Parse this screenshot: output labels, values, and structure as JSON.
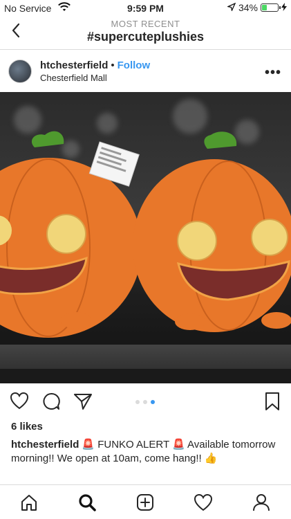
{
  "status_bar": {
    "carrier": "No Service",
    "time": "9:59 PM",
    "battery_percent_label": "34%",
    "battery_level": 0.34,
    "battery_color": "#4cd964"
  },
  "header": {
    "subtitle": "MOST RECENT",
    "title": "#supercuteplushies",
    "back_icon": "chevron-left-icon"
  },
  "post": {
    "username": "htchesterfield",
    "dot": "•",
    "follow_label": "Follow",
    "location": "Chesterfield Mall",
    "more_icon": "ellipsis-icon",
    "more_label": "•••",
    "image_description": "",
    "carousel": {
      "count": 3,
      "active_index": 2
    },
    "likes": "6 likes",
    "caption_user": "htchesterfield",
    "caption_text": "🚨 FUNKO ALERT 🚨 Available tomorrow morning!! We open at 10am, come hang!! 👍"
  },
  "actions": {
    "icons": [
      "heart-icon",
      "comment-icon",
      "share-icon",
      "bookmark-icon"
    ]
  },
  "tab_bar": {
    "items": [
      "home-icon",
      "search-icon",
      "new-post-icon",
      "activity-icon",
      "profile-icon"
    ]
  },
  "colors": {
    "link": "#3897f0",
    "pumpkin": "#e8772a",
    "stem": "#4f9a2e",
    "eye": "#f1d679"
  }
}
